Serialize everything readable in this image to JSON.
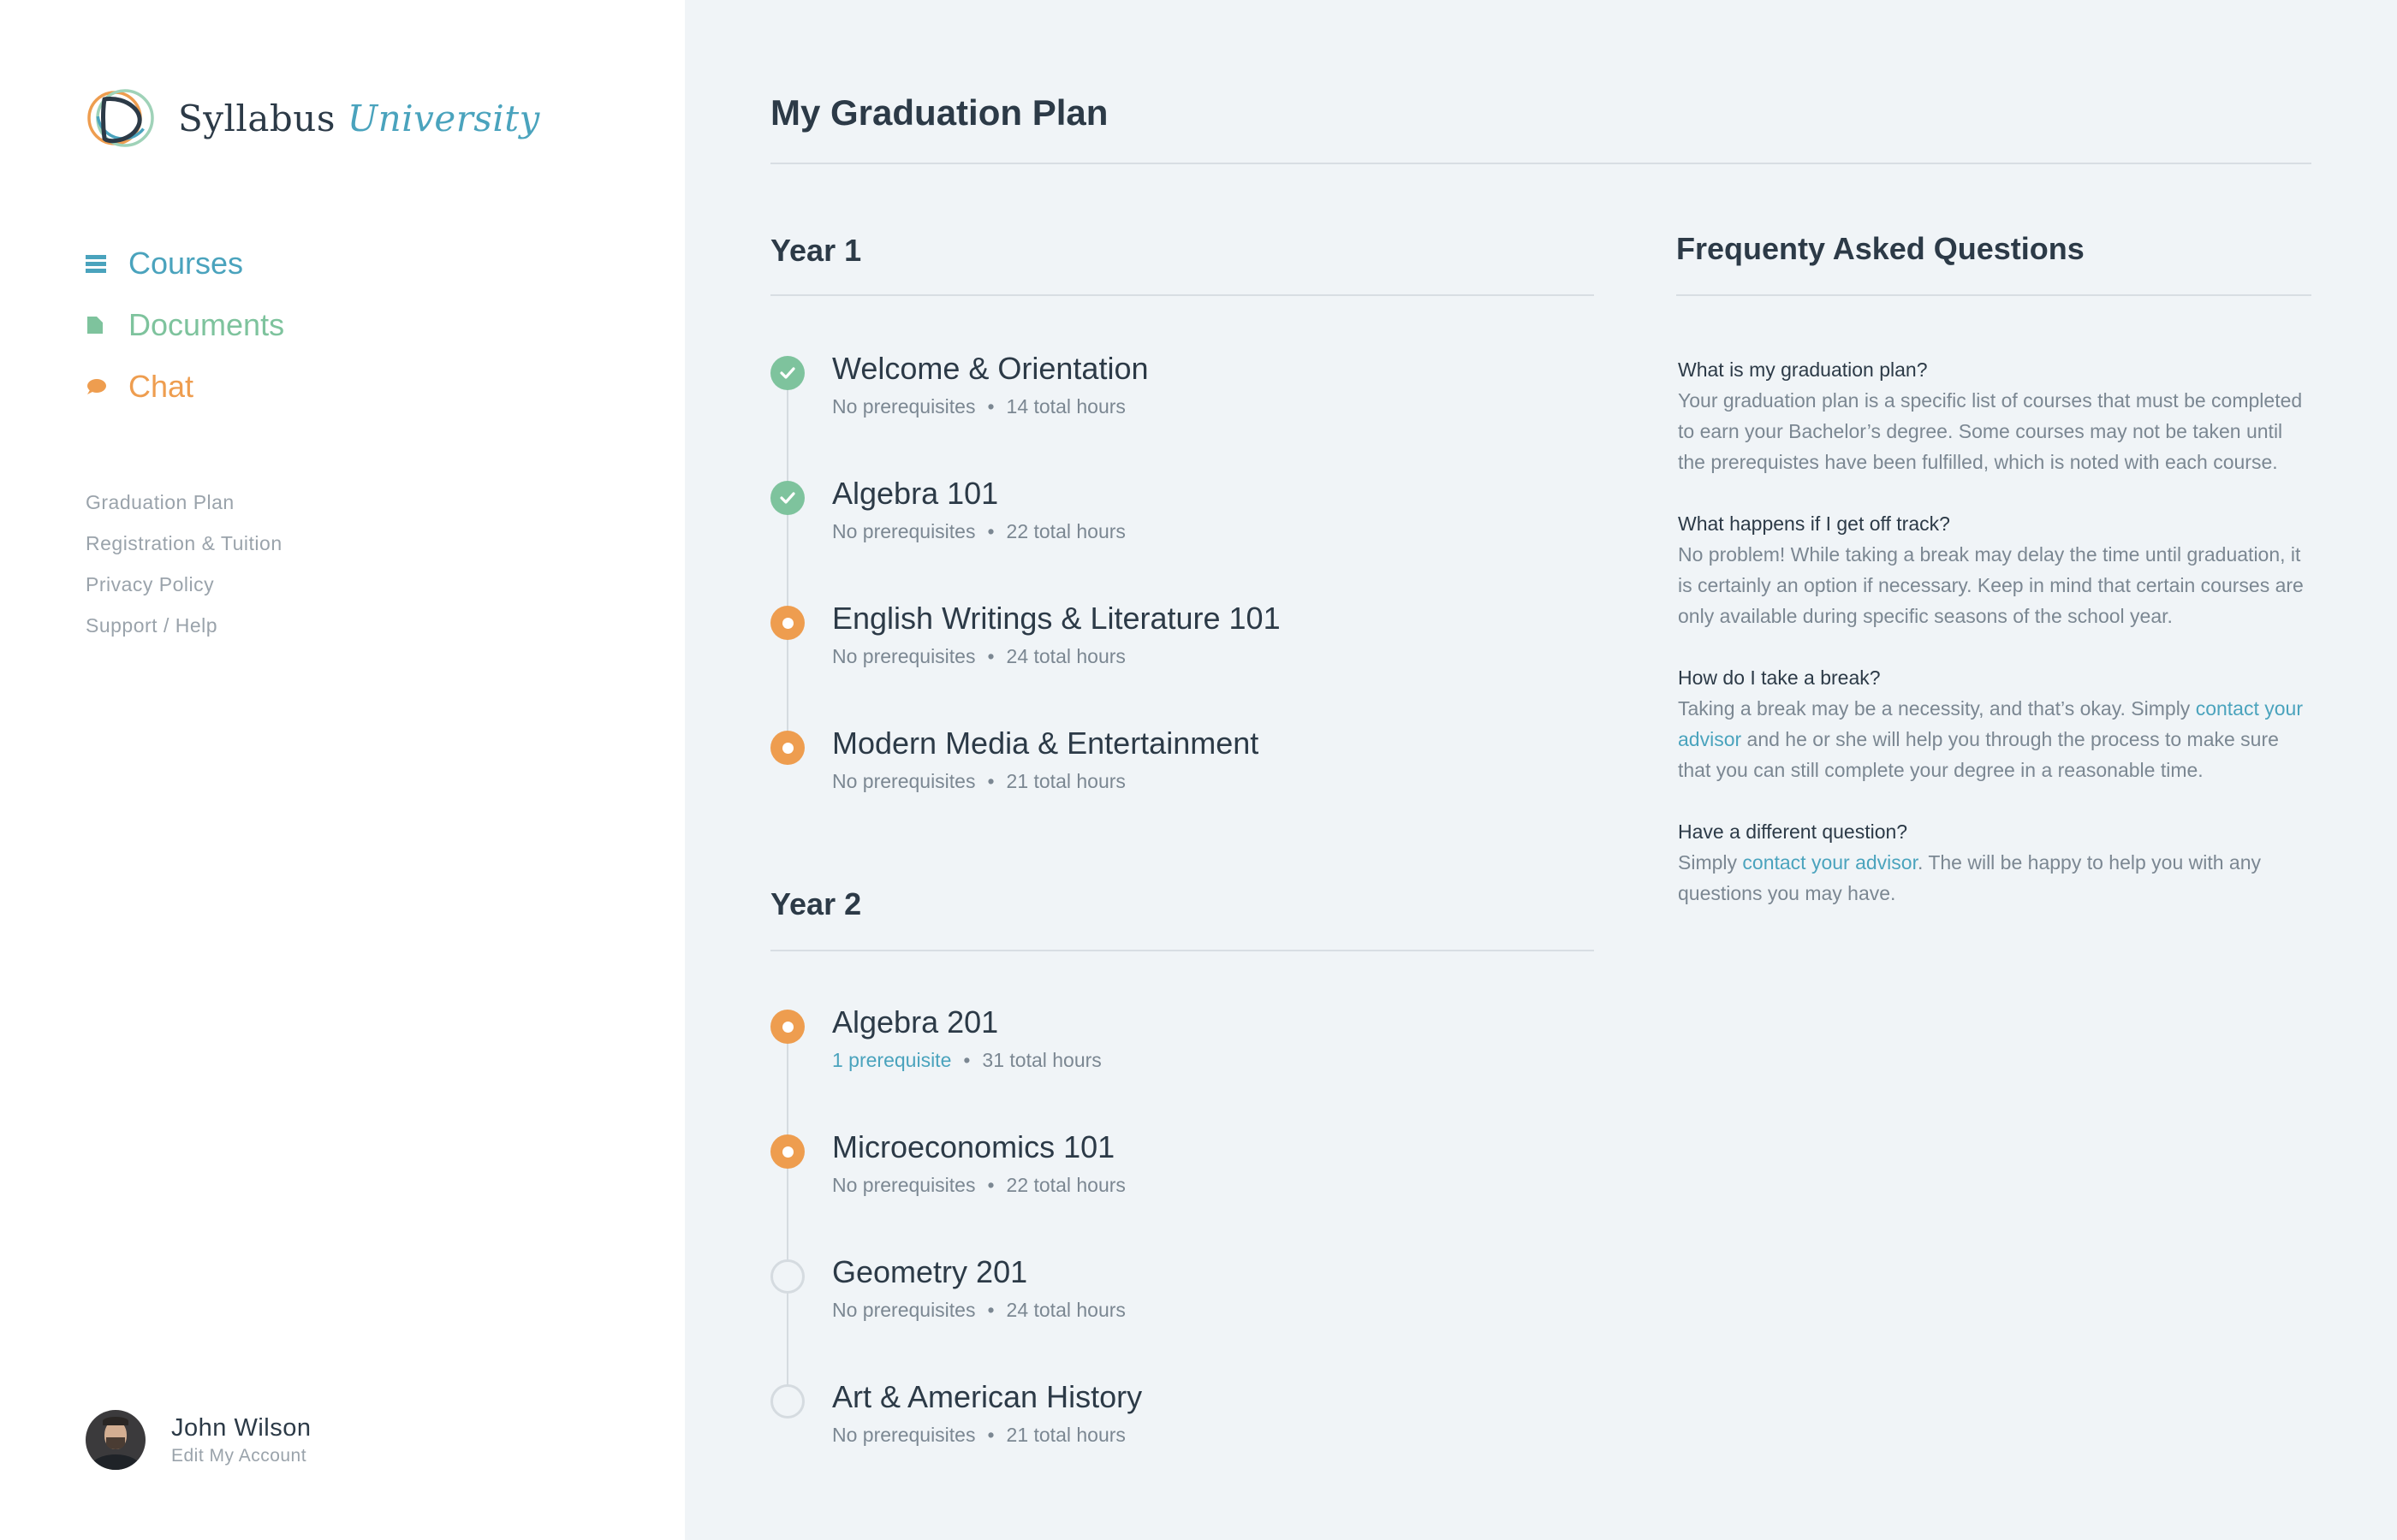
{
  "brand": {
    "name": "Syllabus",
    "name_accent": "University",
    "icon": "logo-mark-icon",
    "colors": {
      "blue": "#4aa3bd",
      "green": "#7ec39d",
      "orange": "#ee9d4f",
      "navy": "#2c3a47"
    }
  },
  "sidebar": {
    "nav": [
      {
        "label": "Courses",
        "icon": "list-icon",
        "color": "#4aa3bd"
      },
      {
        "label": "Documents",
        "icon": "document-icon",
        "color": "#7ec39d"
      },
      {
        "label": "Chat",
        "icon": "chat-bubble-icon",
        "color": "#ee9d4f"
      }
    ],
    "links": [
      "Graduation Plan",
      "Registration & Tuition",
      "Privacy Policy",
      "Support / Help"
    ],
    "user": {
      "name": "John Wilson",
      "edit_label": "Edit My Account"
    }
  },
  "main": {
    "title": "My Graduation Plan",
    "years": [
      {
        "heading": "Year 1",
        "courses": [
          {
            "title": "Welcome & Orientation",
            "prereq": "No prerequisites",
            "hours": "14 total hours",
            "status": "completed"
          },
          {
            "title": "Algebra 101",
            "prereq": "No prerequisites",
            "hours": "22 total hours",
            "status": "completed"
          },
          {
            "title": "English Writings & Literature 101",
            "prereq": "No prerequisites",
            "hours": "24 total hours",
            "status": "in-progress"
          },
          {
            "title": "Modern Media & Entertainment",
            "prereq": "No prerequisites",
            "hours": "21 total hours",
            "status": "in-progress"
          }
        ]
      },
      {
        "heading": "Year 2",
        "courses": [
          {
            "title": "Algebra 201",
            "prereq": "1 prerequisite",
            "hours": "31 total hours",
            "status": "in-progress"
          },
          {
            "title": "Microeconomics 101",
            "prereq": "No prerequisites",
            "hours": "22 total hours",
            "status": "in-progress"
          },
          {
            "title": "Geometry 201",
            "prereq": "No prerequisites",
            "hours": "24 total hours",
            "status": "not-started"
          },
          {
            "title": "Art & American History",
            "prereq": "No prerequisites",
            "hours": "21 total hours",
            "status": "not-started"
          }
        ]
      }
    ],
    "separator": "•"
  },
  "faq": {
    "heading": "Frequenty Asked Questions",
    "items": [
      {
        "q": "What is my graduation plan?",
        "a1": "Your graduation plan is a specific list of courses that must be completed to earn your Bachelor’s degree. Some courses may not be taken until the prerequistes have been fulfilled, which is noted with each course."
      },
      {
        "q": "What happens if I get off track?",
        "a1": "No problem! While taking a break may delay the time until graduation, it is certainly an option if necessary. Keep in mind that certain courses are only available during specific seasons of the school year."
      },
      {
        "q": "How do I take a break?",
        "a1": "Taking a break may be a necessity, and that’s okay. Simply ",
        "link": "contact your advisor",
        "a2": " and he or she will help you through the process to make sure that you can still complete your degree in a reasonable time."
      },
      {
        "q": "Have a different question?",
        "a1": "Simply ",
        "link": "contact your advisor",
        "a2": ". The will be happy to help you with any questions you may have."
      }
    ]
  }
}
